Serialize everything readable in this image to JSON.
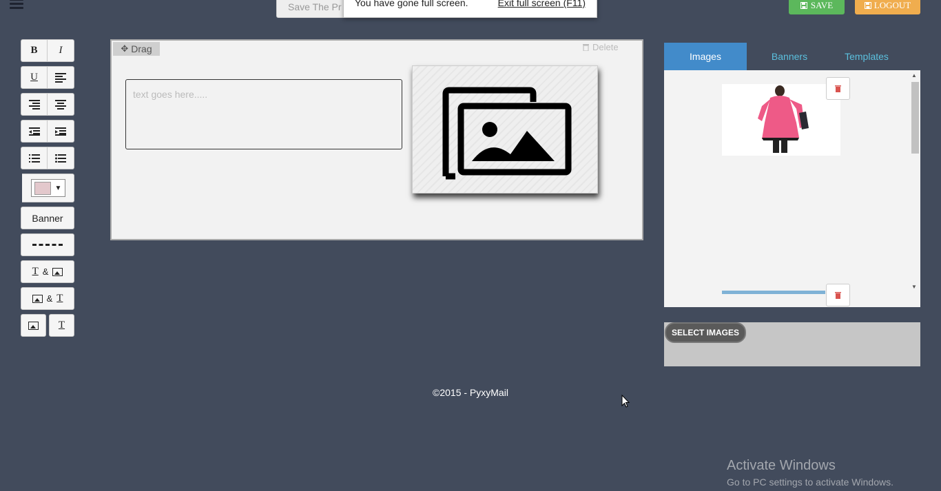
{
  "header": {
    "menu_icon": "hamburger-menu-icon",
    "save_project_label": "Save The Pr",
    "fullscreen_message": "You have gone full screen.",
    "fullscreen_exit_label": "Exit full screen (F11)",
    "save_label": "SAVE",
    "logout_label": "LOGOUT",
    "colors": {
      "save": "#5cb85c",
      "logout": "#f0ad4e"
    }
  },
  "toolbar": {
    "bold_label": "B",
    "italic_label": "I",
    "underline_label": "U",
    "color_value": "#e3c8cc",
    "color_arrow": "▼",
    "banner_label": "Banner",
    "amp_label": "&",
    "text_glyph": "T"
  },
  "editor": {
    "drag_label": "Drag",
    "delete_label": "Delete",
    "text_placeholder": "text goes here....."
  },
  "side_panel": {
    "tabs": [
      {
        "label": "Images",
        "active": true
      },
      {
        "label": "Banners",
        "active": false
      },
      {
        "label": "Templates",
        "active": false
      }
    ],
    "select_images_label": "SELECT IMAGES",
    "accent_color": "#428bca"
  },
  "footer": {
    "copyright": "©2015 - PyxyMail"
  },
  "watermark": {
    "title": "Activate Windows",
    "subtitle": "Go to PC settings to activate Windows."
  }
}
